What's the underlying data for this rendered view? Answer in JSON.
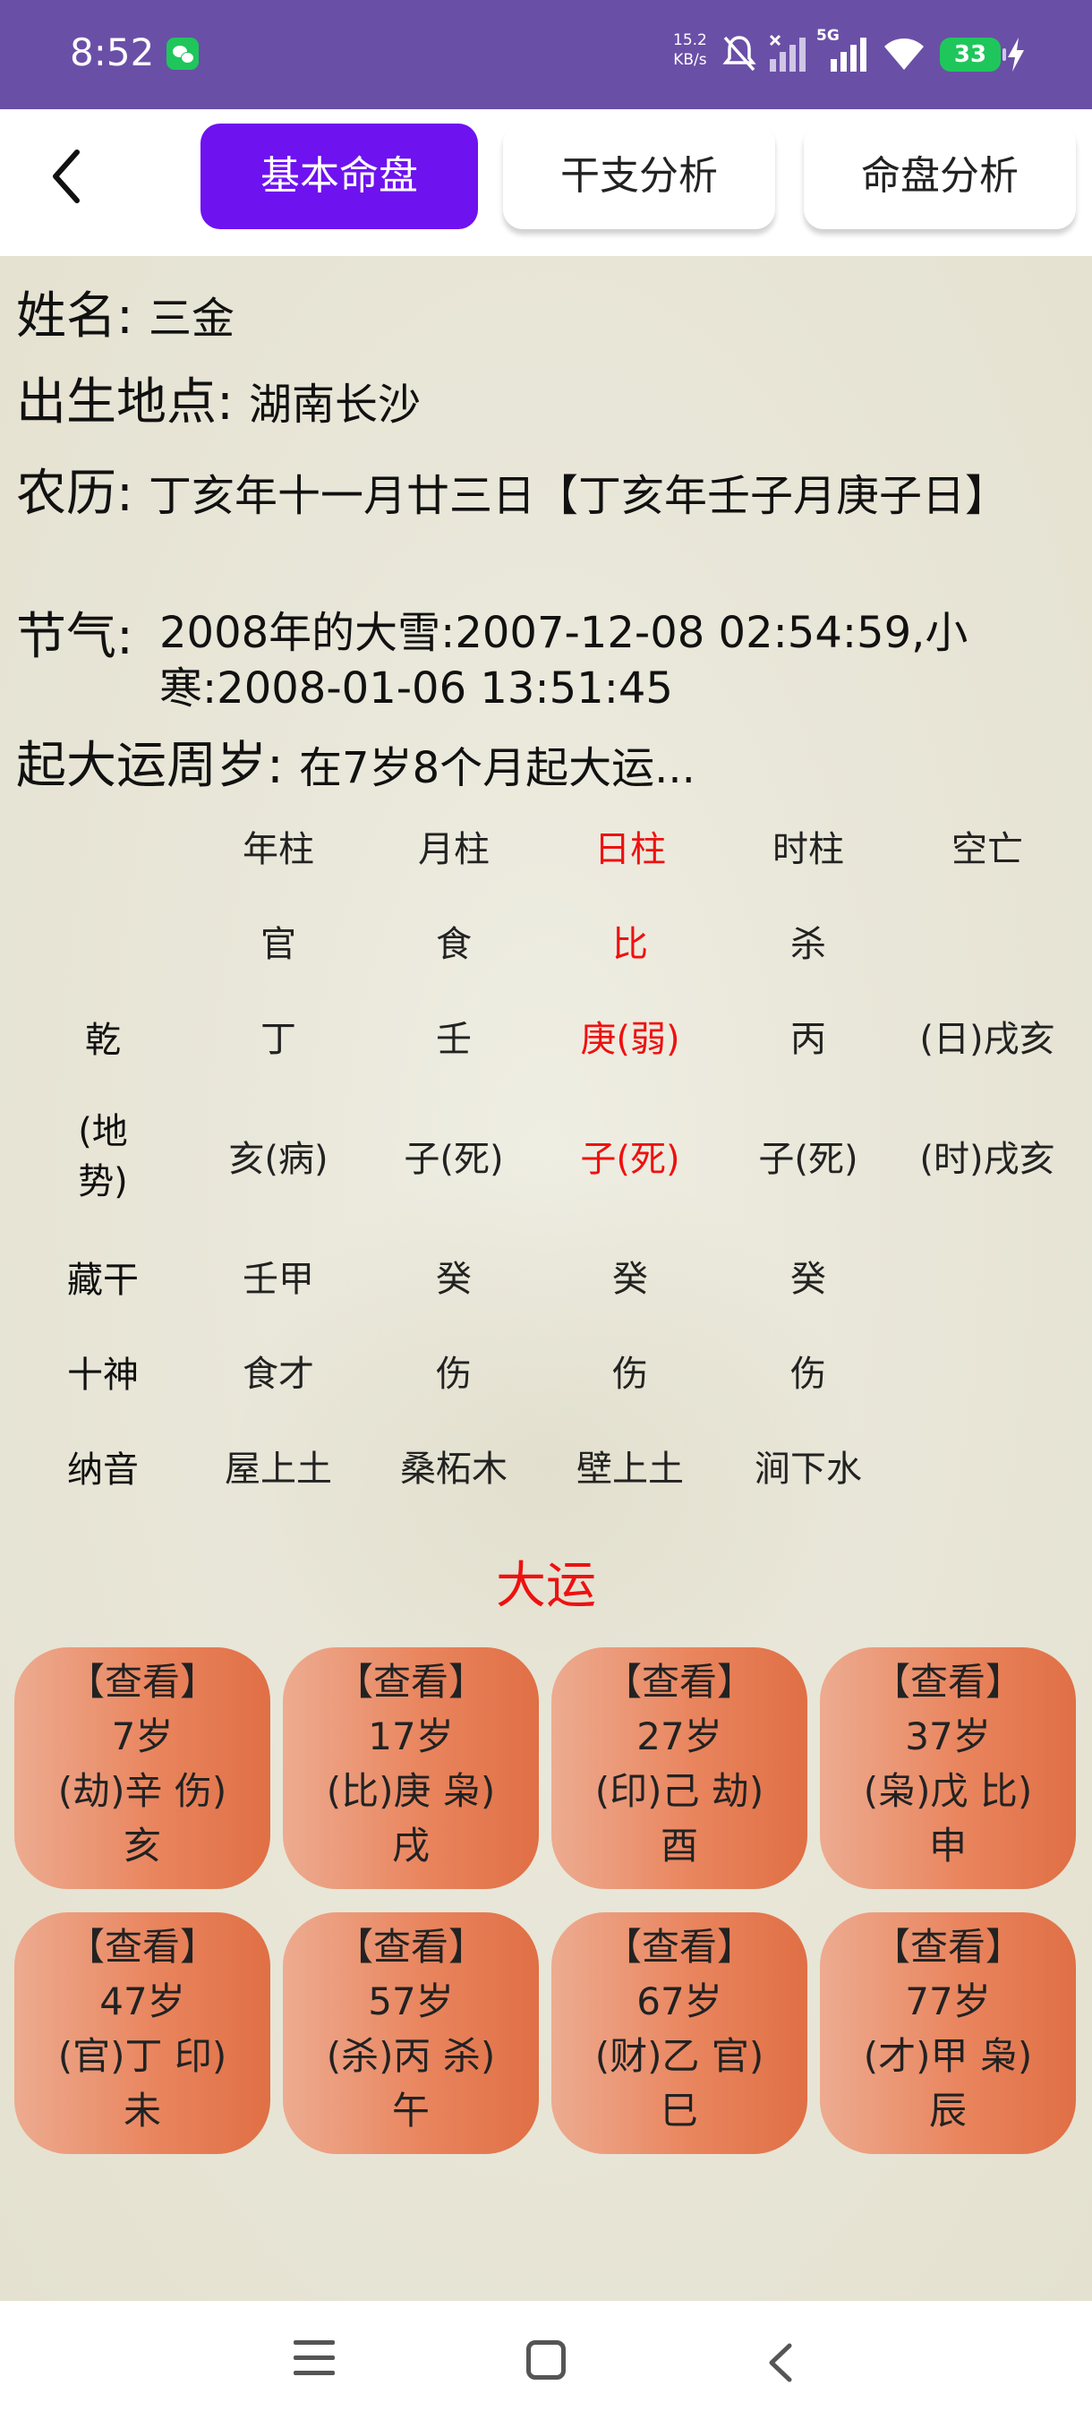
{
  "status_bar": {
    "time": "8:52",
    "net_speed_value": "15.2",
    "net_speed_unit": "KB/s",
    "network_type": "5G",
    "battery": "33",
    "icons": [
      "wechat-icon",
      "mute-icon",
      "signal-icon",
      "signal-5g-icon",
      "wifi-icon",
      "battery-icon",
      "charging-icon"
    ]
  },
  "header": {
    "tabs": [
      {
        "label": "基本命盘",
        "active": true
      },
      {
        "label": "干支分析",
        "active": false
      },
      {
        "label": "命盘分析",
        "active": false
      }
    ]
  },
  "info": {
    "name_label": "姓名:",
    "name_value": "三金",
    "birthplace_label": "出生地点:",
    "birthplace_value": "湖南长沙",
    "lunar_label": "农历:",
    "lunar_value": "丁亥年十一月廿三日【丁亥年壬子月庚子日】",
    "jieqi_label": "节气:",
    "jieqi_value": "2008年的大雪:2007-12-08 02:54:59,小寒:2008-01-06 13:51:45",
    "qiyun_label": "起大运周岁:",
    "qiyun_value": "在7岁8个月起大运..."
  },
  "pillars": {
    "headers": [
      "年柱",
      "月柱",
      "日柱",
      "时柱",
      "空亡"
    ],
    "gods": [
      "官",
      "食",
      "比",
      "杀"
    ],
    "qian_label": "乾",
    "stems": [
      "丁",
      "壬",
      "庚(弱)",
      "丙",
      "(日)戌亥"
    ],
    "dishi_label_line1": "(地",
    "dishi_label_line2": "势)",
    "branches": [
      "亥(病)",
      "子(死)",
      "子(死)",
      "子(死)",
      "(时)戌亥"
    ],
    "canggan_label": "藏干",
    "canggan": [
      "壬甲",
      "癸",
      "癸",
      "癸"
    ],
    "shishen_label": "十神",
    "shishen": [
      "食才",
      "伤",
      "伤",
      "伤"
    ],
    "nayin_label": "纳音",
    "nayin": [
      "屋上土",
      "桑柘木",
      "壁上土",
      "涧下水"
    ],
    "highlight_color": "#e11111"
  },
  "dayun": {
    "title": "大运",
    "cards": [
      {
        "view": "【查看】",
        "age": "7岁",
        "gan": "(劫)辛 伤)",
        "zhi": "亥"
      },
      {
        "view": "【查看】",
        "age": "17岁",
        "gan": "(比)庚 枭)",
        "zhi": "戌"
      },
      {
        "view": "【查看】",
        "age": "27岁",
        "gan": "(印)己 劫)",
        "zhi": "酉"
      },
      {
        "view": "【查看】",
        "age": "37岁",
        "gan": "(枭)戊 比)",
        "zhi": "申"
      },
      {
        "view": "【查看】",
        "age": "47岁",
        "gan": "(官)丁 印)",
        "zhi": "未"
      },
      {
        "view": "【查看】",
        "age": "57岁",
        "gan": "(杀)丙 杀)",
        "zhi": "午"
      },
      {
        "view": "【查看】",
        "age": "67岁",
        "gan": "(财)乙 官)",
        "zhi": "巳"
      },
      {
        "view": "【查看】",
        "age": "77岁",
        "gan": "(才)甲 枭)",
        "zhi": "辰"
      }
    ]
  },
  "colors": {
    "status_bar": "#6a4fa7",
    "active_tab": "#6e12f0",
    "card_orange": "#e9855e",
    "accent_red": "#e11111"
  }
}
